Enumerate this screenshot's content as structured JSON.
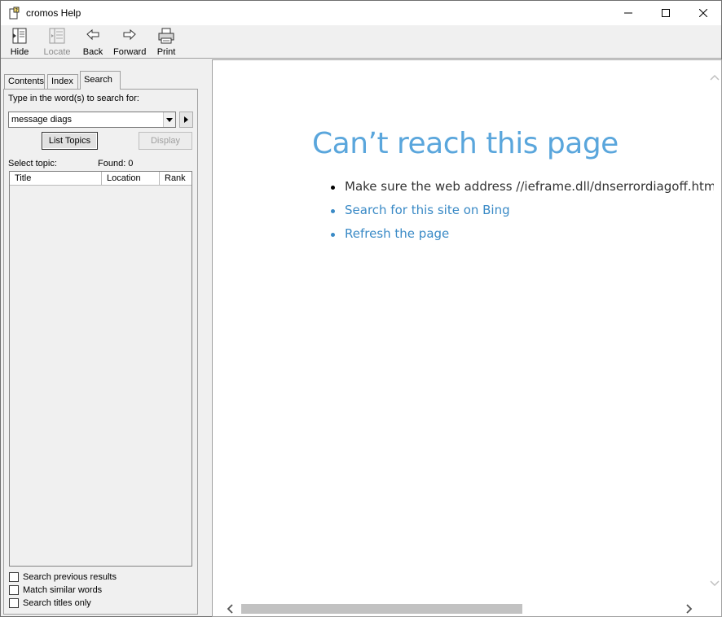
{
  "window": {
    "title": "cromos Help"
  },
  "toolbar": {
    "hide": "Hide",
    "locate": "Locate",
    "back": "Back",
    "forward": "Forward",
    "print": "Print"
  },
  "tabs": {
    "contents": "Contents",
    "index": "Index",
    "search": "Search"
  },
  "search_panel": {
    "instruction": "Type in the word(s) to search for:",
    "query": "message diags",
    "list_topics": "List Topics",
    "display": "Display",
    "select_topic": "Select topic:",
    "found": "Found: 0",
    "columns": [
      "Title",
      "Location",
      "Rank"
    ],
    "options": [
      "Search previous results",
      "Match similar words",
      "Search titles only"
    ]
  },
  "content": {
    "heading": "Can’t reach this page",
    "bullets": [
      "Make sure the web address //ieframe.dll/dnserrordiagoff.htm# is correct",
      "Search for this site on Bing",
      "Refresh the page"
    ]
  },
  "colors": {
    "heading": "#5aa6dc",
    "link": "#3a8ac6"
  }
}
